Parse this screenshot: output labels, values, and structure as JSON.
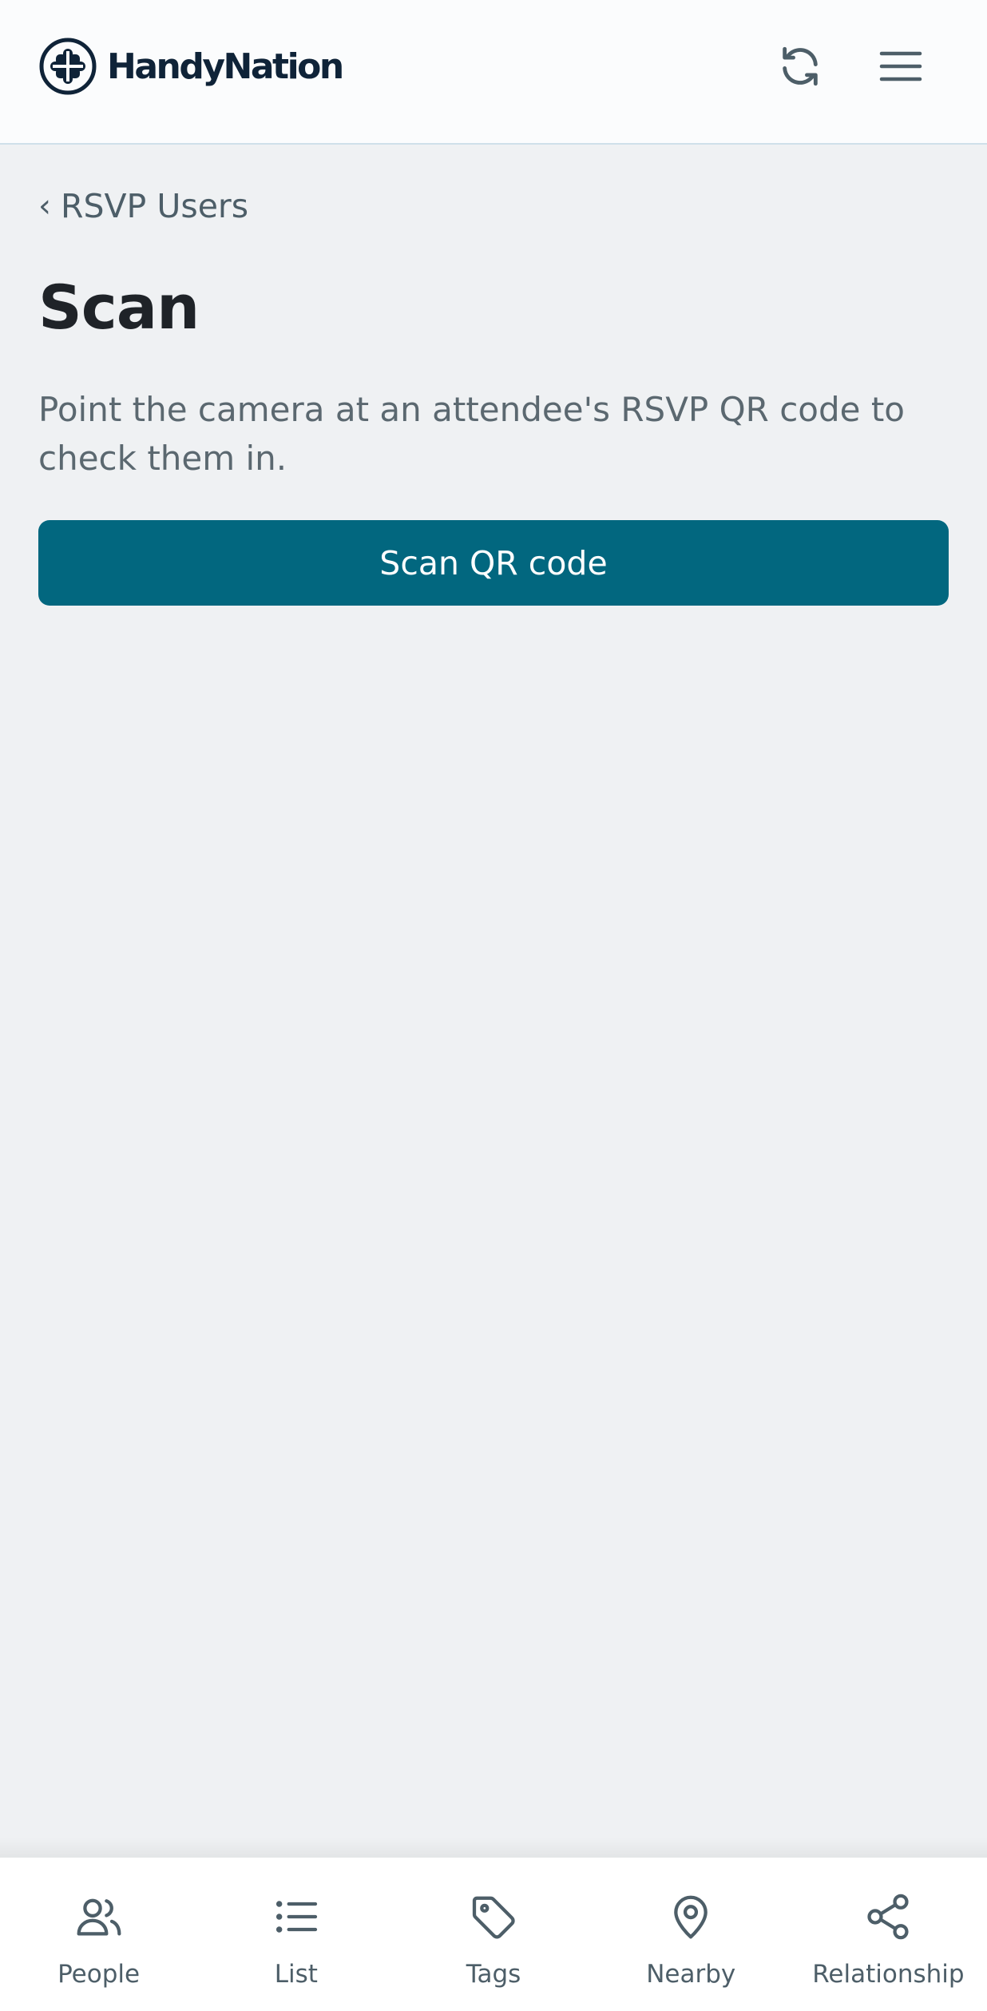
{
  "app": {
    "brand_name": "HandyNation"
  },
  "header": {
    "refresh_icon": "refresh-icon",
    "menu_icon": "hamburger-menu-icon"
  },
  "main": {
    "back_link_label": "RSVP Users",
    "title": "Scan",
    "description": "Point the camera at an attendee's RSVP QR code to check them in.",
    "scan_button_label": "Scan QR code"
  },
  "bottom_nav": {
    "items": [
      {
        "label": "People",
        "icon": "people-icon"
      },
      {
        "label": "List",
        "icon": "list-icon"
      },
      {
        "label": "Tags",
        "icon": "tag-icon"
      },
      {
        "label": "Nearby",
        "icon": "location-pin-icon"
      },
      {
        "label": "Relationship",
        "icon": "share-nodes-icon"
      }
    ]
  },
  "colors": {
    "primary_button": "#02677f",
    "background": "#eff1f3",
    "header_background": "#fbfcfd",
    "brand_text": "#0f2338",
    "muted_text": "#4d5e68"
  }
}
